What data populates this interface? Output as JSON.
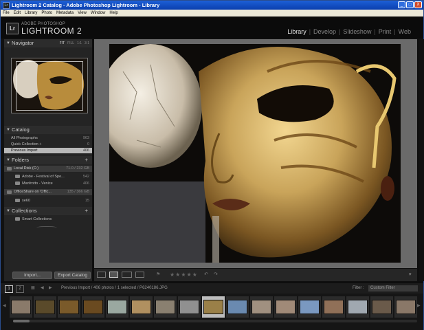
{
  "window": {
    "title": "Lightroom 2 Catalog - Adobe Photoshop Lightroom - Library",
    "buttons": [
      "_",
      "□",
      "X"
    ]
  },
  "menu": [
    "File",
    "Edit",
    "Library",
    "Photo",
    "Metadata",
    "View",
    "Window",
    "Help"
  ],
  "identity": {
    "logo": "Lr",
    "brand": "ADOBE PHOTOSHOP",
    "product": "LIGHTROOM 2"
  },
  "modules": {
    "items": [
      "Library",
      "Develop",
      "Slideshow",
      "Print",
      "Web"
    ],
    "separator": "|",
    "active": "Library"
  },
  "navigator": {
    "title": "Navigator",
    "modes": [
      "FIT",
      "FILL",
      "1:1",
      "3:1"
    ]
  },
  "catalog": {
    "title": "Catalog",
    "items": [
      {
        "label": "All Photographs",
        "count": "963"
      },
      {
        "label": "Quick Collection +",
        "count": "0"
      },
      {
        "label": "Previous Import",
        "count": "406"
      }
    ]
  },
  "folders": {
    "title": "Folders",
    "plus": "+",
    "volumes": [
      {
        "label": "Local Disk (C:)",
        "info": "71.0 / 232 GB"
      },
      {
        "label": "OfficeShare on 'Offic...",
        "info": "135 / 366 GB"
      }
    ],
    "items": [
      {
        "label": "Adobe - Festival of Spe...",
        "count": "542"
      },
      {
        "label": "Manfrotto - Venice",
        "count": "406"
      },
      {
        "label": "se60",
        "count": "15"
      }
    ]
  },
  "collections": {
    "title": "Collections",
    "plus": "+",
    "items": [
      {
        "label": "Smart Collections"
      }
    ]
  },
  "buttons": {
    "import": "Import...",
    "export": "Export Catalog"
  },
  "toolbar": {
    "stars": "★★★★★"
  },
  "filmstrip_bar": {
    "pages": [
      "1",
      "2"
    ],
    "breadcrumb": "Previous Import / 406 photos / 1 selected / P6240186.JPG",
    "filter_label": "Filter :",
    "filter_value": "Custom Filter"
  },
  "colors": {
    "titlebar": "#0b3fae",
    "panel": "#242424",
    "content_bg": "#6a6a6a",
    "selected_row": "#b8b8b8",
    "mask_gold": "#c9a45a"
  },
  "filmstrip": {
    "selected_index": 8,
    "thumbs": [
      {
        "color": "#8a7a6a"
      },
      {
        "color": "#5a4a2a"
      },
      {
        "color": "#7a5a2a"
      },
      {
        "color": "#6a4a20"
      },
      {
        "color": "#9aa8a0"
      },
      {
        "color": "#b09060"
      },
      {
        "color": "#8a8070"
      },
      {
        "color": "#909090"
      },
      {
        "color": "#9a8048"
      },
      {
        "color": "#6a8ab0"
      },
      {
        "color": "#a09080"
      },
      {
        "color": "#a08a78"
      },
      {
        "color": "#7a98c0"
      },
      {
        "color": "#907058"
      },
      {
        "color": "#a0a8b0"
      },
      {
        "color": "#6a5a4a"
      },
      {
        "color": "#8a7868"
      }
    ]
  }
}
